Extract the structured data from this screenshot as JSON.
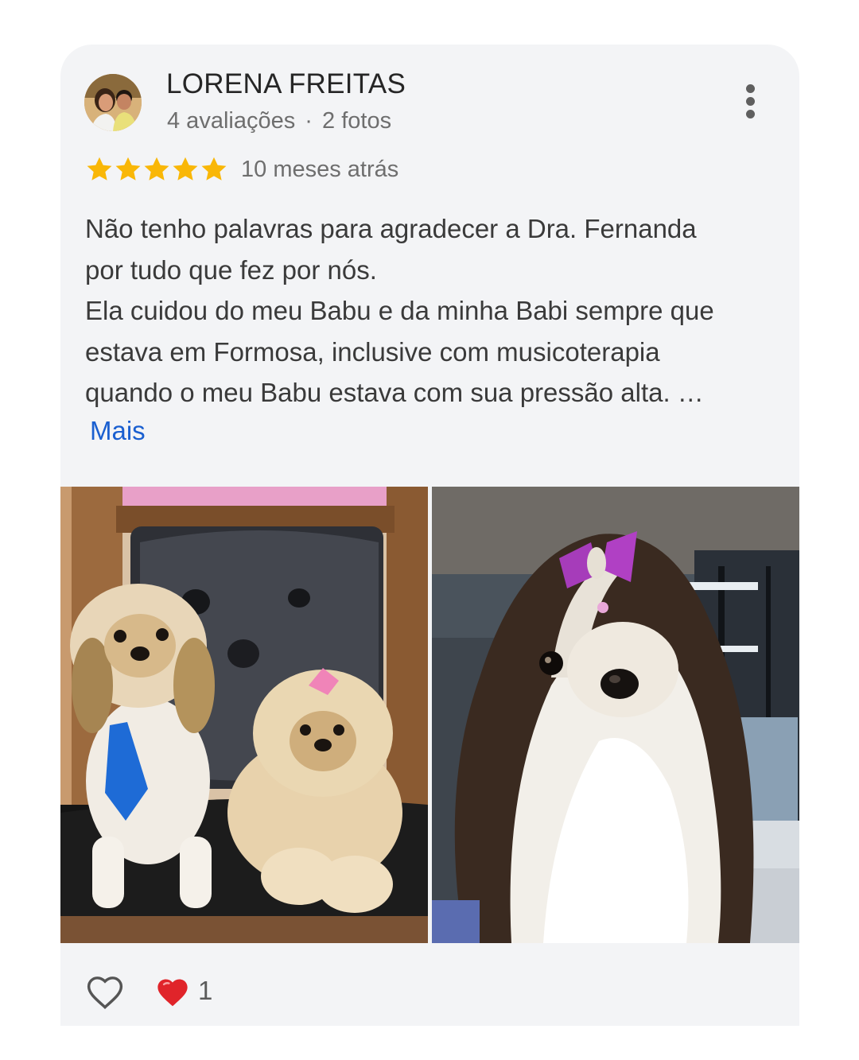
{
  "review": {
    "author": "LORENA FREITAS",
    "reviews_count": "4 avaliações",
    "separator": "·",
    "photos_count": "2 fotos",
    "rating": 5,
    "time_ago": "10 meses atrás",
    "text_lines": [
      "Não tenho palavras para agradecer a Dra. Fernanda",
      "por tudo que fez por nós.",
      "Ela cuidou do meu Babu e da minha Babi sempre que",
      "estava em Formosa, inclusive com musicoterapia",
      "quando o meu Babu estava com sua pressão alta. …"
    ],
    "more_label": "Mais",
    "likes": "1"
  },
  "icons": {
    "menu": "more-vert-icon",
    "star": "star-icon",
    "like": "heart-outline-icon",
    "liked": "heart-filled-icon"
  },
  "colors": {
    "card_background": "#f3f4f6",
    "star": "#f9b707",
    "link": "#1a5fd0",
    "heart": "#e0242a"
  }
}
